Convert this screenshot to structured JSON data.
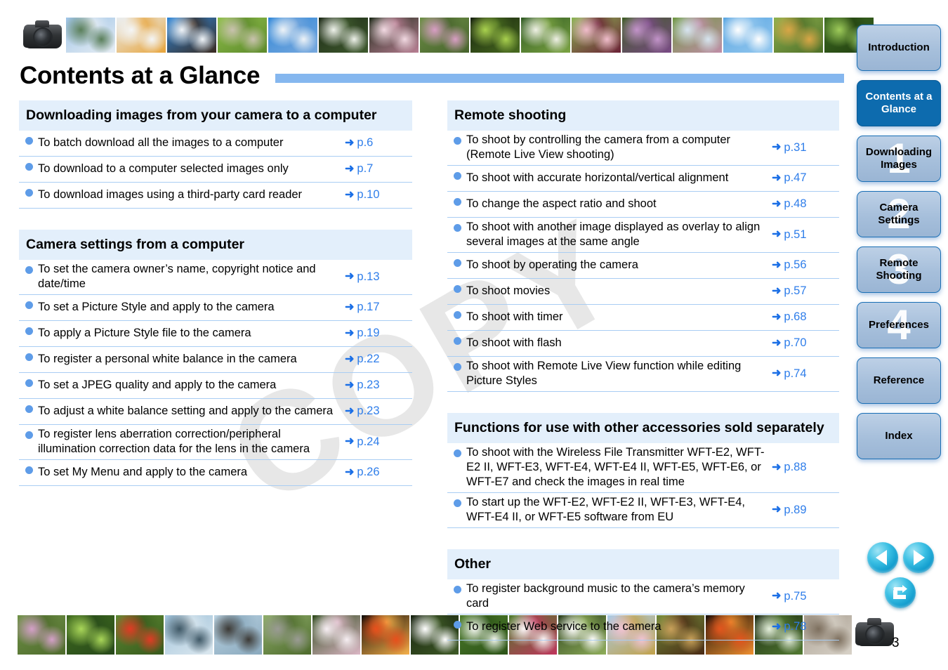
{
  "page_title": "Contents at a Glance",
  "page_number": "3",
  "watermark": "COPY",
  "columns": {
    "left": [
      {
        "heading": "Downloading images from your camera to a computer",
        "rows": [
          {
            "label": "To batch download all the images to a computer",
            "arrow": "➜",
            "page": "p.6"
          },
          {
            "label": "To download to a computer selected images only",
            "arrow": "➜",
            "page": "p.7"
          },
          {
            "label": "To download images using a third-party card reader",
            "arrow": "➜",
            "page": "p.10"
          }
        ]
      },
      {
        "heading": "Camera settings from a computer",
        "rows": [
          {
            "label": "To set the camera owner’s name, copyright notice and date/time",
            "arrow": "➜",
            "page": "p.13"
          },
          {
            "label": "To set a Picture Style and apply to the camera",
            "arrow": "➜",
            "page": "p.17"
          },
          {
            "label": "To apply a Picture Style file to the camera",
            "arrow": "➜",
            "page": "p.19"
          },
          {
            "label": "To register a personal white balance in the camera",
            "arrow": "➜",
            "page": "p.22"
          },
          {
            "label": "To set a JPEG quality and apply to the camera",
            "arrow": "➜",
            "page": "p.23"
          },
          {
            "label": "To adjust a white balance setting and apply to the camera",
            "arrow": "➜",
            "page": "p.23"
          },
          {
            "label": "To register lens aberration correction/peripheral illumination correction data for the lens in the camera",
            "arrow": "➜",
            "page": "p.24"
          },
          {
            "label": "To set My Menu and apply to the camera",
            "arrow": "➜",
            "page": "p.26"
          }
        ]
      }
    ],
    "right": [
      {
        "heading": "Remote shooting",
        "rows": [
          {
            "label": "To shoot by controlling the camera from a computer (Remote Live View shooting)",
            "arrow": "➜",
            "page": "p.31"
          },
          {
            "label": "To shoot with accurate horizontal/vertical alignment",
            "arrow": "➜",
            "page": "p.47"
          },
          {
            "label": "To change the aspect ratio and shoot",
            "arrow": "➜",
            "page": "p.48"
          },
          {
            "label": "To shoot with another image displayed as overlay to align several images at the same angle",
            "arrow": "➜",
            "page": "p.51"
          },
          {
            "label": "To shoot by operating the camera",
            "arrow": "➜",
            "page": "p.56"
          },
          {
            "label": "To shoot movies",
            "arrow": "➜",
            "page": "p.57"
          },
          {
            "label": "To shoot with timer",
            "arrow": "➜",
            "page": "p.68"
          },
          {
            "label": "To shoot with flash",
            "arrow": "➜",
            "page": "p.70"
          },
          {
            "label": "To shoot with Remote Live View function while editing Picture Styles",
            "arrow": "➜",
            "page": "p.74"
          }
        ]
      },
      {
        "heading": "Functions for use with other accessories sold separately",
        "rows": [
          {
            "label": "To shoot with the Wireless File Transmitter WFT-E2, WFT-E2 II, WFT-E3, WFT-E4, WFT-E4 II, WFT-E5, WFT-E6, or WFT-E7 and check the images in real time",
            "arrow": "➜",
            "page": "p.88"
          },
          {
            "label": "To start up the WFT-E2, WFT-E2 II, WFT-E3, WFT-E4, WFT-E4 II, or WFT-E5 software from EU",
            "arrow": "➜",
            "page": "p.89"
          }
        ]
      },
      {
        "heading": "Other",
        "rows": [
          {
            "label": "To register background music to the camera’s memory card",
            "arrow": "➜",
            "page": "p.75"
          },
          {
            "label": "To register Web service to the camera",
            "arrow": "➜",
            "page": "p.78"
          }
        ]
      }
    ]
  },
  "sidebar": {
    "tabs": [
      {
        "label": "Introduction",
        "num": "",
        "active": false
      },
      {
        "label": "Contents at a Glance",
        "num": "",
        "active": true
      },
      {
        "label": "Downloading Images",
        "num": "1",
        "active": false
      },
      {
        "label": "Camera Settings",
        "num": "2",
        "active": false
      },
      {
        "label": "Remote Shooting",
        "num": "3",
        "active": false
      },
      {
        "label": "Preferences",
        "num": "4",
        "active": false
      },
      {
        "label": "Reference",
        "num": "",
        "active": false
      },
      {
        "label": "Index",
        "num": "",
        "active": false
      }
    ]
  },
  "nav_buttons": [
    {
      "name": "previous-page-button",
      "icon": "triangle-left-icon"
    },
    {
      "name": "next-page-button",
      "icon": "triangle-right-icon"
    },
    {
      "name": "return-button",
      "icon": "return-arrow-icon"
    }
  ],
  "colors": {
    "accent_blue": "#2f7eea",
    "bullet_blue": "#5e9ce8",
    "section_header_bg": "#e3effb",
    "rule_blue": "#85b7ef",
    "row_divider": "#a9cdf3",
    "tab_active_bg": "#0d6bae",
    "tab_inactive_bg": "#a6bfdb",
    "nav_button": "#119ccd"
  },
  "top_strip": [
    {
      "name": "camera-photo",
      "type": "camera"
    },
    {
      "name": "thumb-mountain",
      "c1": "#9dc3e6",
      "c2": "#5a7f5a",
      "c3": "#e8eef4"
    },
    {
      "name": "thumb-swan",
      "c1": "#e9eef2",
      "c2": "#f4f6f7",
      "c3": "#e8a43a"
    },
    {
      "name": "thumb-plum-blossom",
      "c1": "#2f86d8",
      "c2": "#f0f4f8",
      "c3": "#3a2a1f"
    },
    {
      "name": "thumb-sprouts",
      "c1": "#8fbf4a",
      "c2": "#c9c2ae",
      "c3": "#5d8a2c"
    },
    {
      "name": "thumb-white-blossoms-sky",
      "c1": "#2f86d8",
      "c2": "#eef3f7",
      "c3": "#79a9dd"
    },
    {
      "name": "thumb-white-flowers-dark",
      "c1": "#1c2a16",
      "c2": "#eef2ea",
      "c3": "#3f5a2e"
    },
    {
      "name": "thumb-cherry-blossoms",
      "c1": "#1e2a18",
      "c2": "#f2d9e2",
      "c3": "#b97f94"
    },
    {
      "name": "thumb-pink-flower",
      "c1": "#6d8f46",
      "c2": "#d89ec4",
      "c3": "#47632c"
    },
    {
      "name": "thumb-green-leaves",
      "c1": "#16210f",
      "c2": "#a9d14e",
      "c3": "#486b1f"
    },
    {
      "name": "thumb-magnolia",
      "c1": "#2f5a22",
      "c2": "#eef0e4",
      "c3": "#7ba342"
    },
    {
      "name": "thumb-pink-pea-flower",
      "c1": "#8ab552",
      "c2": "#f0bccb",
      "c3": "#6b2036"
    },
    {
      "name": "thumb-purple-flowers",
      "c1": "#3d5c24",
      "c2": "#c293c9",
      "c3": "#7a4a86"
    },
    {
      "name": "thumb-pale-blue-flowers",
      "c1": "#6f9642",
      "c2": "#d7e5f0",
      "c3": "#c08ea8"
    },
    {
      "name": "thumb-clouds",
      "c1": "#5aa6e2",
      "c2": "#ffffff",
      "c3": "#93c7ee"
    },
    {
      "name": "thumb-dragonfly",
      "c1": "#8cb04f",
      "c2": "#d9a646",
      "c3": "#4f6f28"
    },
    {
      "name": "thumb-fern",
      "c1": "#3c6a22",
      "c2": "#9ecb5a",
      "c3": "#22400f"
    }
  ],
  "bottom_strip": [
    {
      "name": "thumb-bellflowers",
      "c1": "#6f9147",
      "c2": "#d4a0c8",
      "c3": "#4e6b2c"
    },
    {
      "name": "thumb-green-foliage",
      "c1": "#3f6a1f",
      "c2": "#a9d659",
      "c3": "#27491a"
    },
    {
      "name": "thumb-red-flowers",
      "c1": "#5d8a33",
      "c2": "#e03b24",
      "c3": "#37591c"
    },
    {
      "name": "thumb-mountain-range",
      "c1": "#9fc2da",
      "c2": "#3f5866",
      "c3": "#dce8ef"
    },
    {
      "name": "thumb-rock-peak",
      "c1": "#b9d2e2",
      "c2": "#3c3a36",
      "c3": "#8aa9bd"
    },
    {
      "name": "thumb-cicada-tree",
      "c1": "#8fae6a",
      "c2": "#9a9b94",
      "c3": "#4d6a2c"
    },
    {
      "name": "thumb-lotus",
      "c1": "#2f4a1c",
      "c2": "#f6eef2",
      "c3": "#dcb7c6"
    },
    {
      "name": "thumb-fireworks",
      "c1": "#120d08",
      "c2": "#e8501c",
      "c3": "#f6b04a"
    },
    {
      "name": "thumb-white-star-flowers",
      "c1": "#16210f",
      "c2": "#ffffff",
      "c3": "#3e5a26"
    },
    {
      "name": "thumb-grass-white",
      "c1": "#4b7a2a",
      "c2": "#f2f6ee",
      "c3": "#2d5418"
    },
    {
      "name": "thumb-hibiscus",
      "c1": "#4d7a2c",
      "c2": "#fbf6f6",
      "c3": "#c0355c"
    },
    {
      "name": "thumb-butterfly",
      "c1": "#2a3f1c",
      "c2": "#fdfdfb",
      "c3": "#8fae5a"
    },
    {
      "name": "thumb-cosmos",
      "c1": "#a8cbe6",
      "c2": "#f0c3d2",
      "c3": "#c2a24a"
    },
    {
      "name": "thumb-chestnut",
      "c1": "#6f8a3a",
      "c2": "#c8a05a",
      "c3": "#4a2a14"
    },
    {
      "name": "thumb-autumn-maple",
      "c1": "#140d07",
      "c2": "#e2551d",
      "c3": "#f09030"
    },
    {
      "name": "thumb-silver-grass",
      "c1": "#1b2a12",
      "c2": "#e4efdc",
      "c3": "#527a32"
    },
    {
      "name": "thumb-cat",
      "c1": "#a89e90",
      "c2": "#7d6f5e",
      "c3": "#d8d2c8"
    },
    {
      "name": "camera-photo-end",
      "type": "camera"
    }
  ]
}
